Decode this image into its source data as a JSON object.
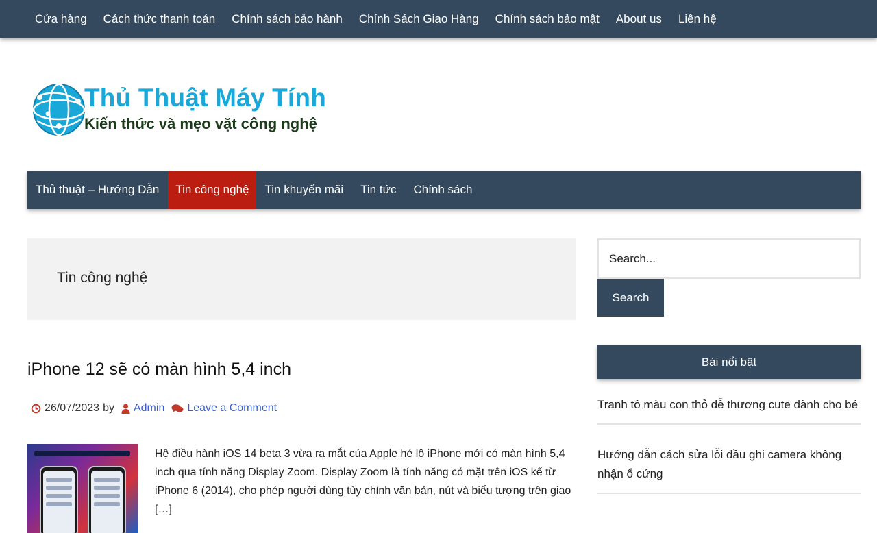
{
  "top_menu": [
    "Cửa hàng",
    "Cách thức thanh toán",
    "Chính sách bảo hành",
    "Chính Sách Giao Hàng",
    "Chính sách bảo mật",
    "About us",
    "Liên hệ"
  ],
  "logo": {
    "title": "Thủ Thuật Máy Tính",
    "tagline": "Kiến thức và mẹo vặt công nghệ",
    "colors": {
      "globe": "#1aa8d8",
      "tagline": "#1b3b1b"
    }
  },
  "main_nav": [
    {
      "label": "Thủ thuật – Hướng Dẫn",
      "active": false
    },
    {
      "label": "Tin công nghệ",
      "active": true
    },
    {
      "label": "Tin khuyến mãi",
      "active": false
    },
    {
      "label": "Tin tức",
      "active": false
    },
    {
      "label": "Chính sách",
      "active": false
    }
  ],
  "archive": {
    "title": "Tin công nghệ"
  },
  "post": {
    "title": "iPhone 12 sẽ có màn hình 5,4 inch",
    "date": "26/07/2023",
    "by": "by",
    "author": "Admin",
    "comment_link": "Leave a Comment",
    "excerpt": "Hệ điều hành iOS 14 beta 3 vừa ra mắt của Apple hé lộ iPhone mới có màn hình 5,4 inch qua tính năng Display Zoom.   Display Zoom là tính năng có mặt trên iOS kể từ iPhone 6 (2014), cho phép người dùng tùy chỉnh văn bản, nút và biểu tượng trên giao […]",
    "thumbnail_icon": "iphone-screens-image"
  },
  "sidebar": {
    "search": {
      "placeholder": "Search...",
      "button": "Search"
    },
    "featured_title": "Bài nổi bật",
    "featured_items": [
      "Tranh tô màu con thỏ dễ thương cute dành cho bé",
      "Hướng dẫn cách sửa lỗi đầu ghi camera không nhận ổ cứng"
    ]
  },
  "colors": {
    "nav_bg": "#34495e",
    "active_bg": "#bb1e10",
    "link": "#3a5fd3",
    "meta_icon": "#c0392b"
  }
}
